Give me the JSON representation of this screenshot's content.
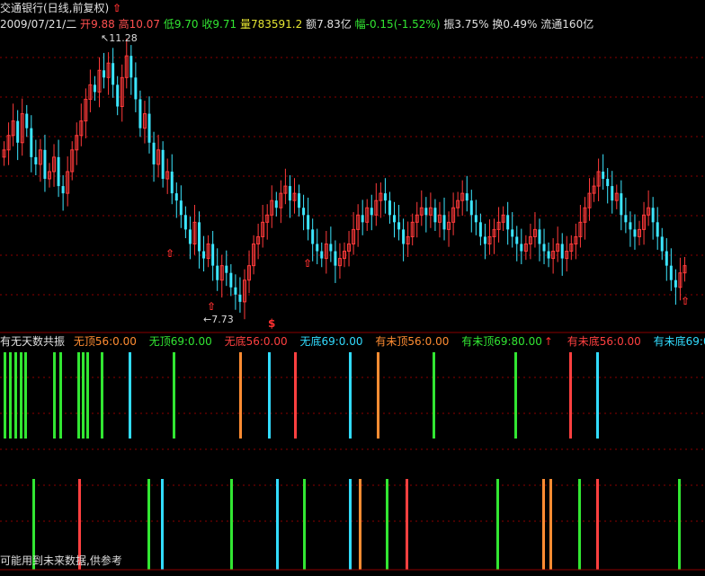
{
  "header": {
    "stock_name": "交通银行(日线,前复权)",
    "date": "2009/07/21/二",
    "open_label": "开",
    "open": "9.88",
    "high_label": "高",
    "high": "10.07",
    "low_label": "低",
    "low": "9.70",
    "close_label": "收",
    "close": "9.71",
    "volume_label": "量",
    "volume": "783591.2",
    "amount_label": "额",
    "amount": "7.83亿",
    "change_label": "幅",
    "change": "-0.15(-1.52%)",
    "amplitude_label": "振",
    "amplitude": "3.75%",
    "turnover_label": "换",
    "turnover": "0.49%",
    "float_label": "流通",
    "float": "160亿"
  },
  "price_chart": {
    "max_label": "11.28",
    "min_label": "7.73",
    "marker_symbol": "$"
  },
  "indicator": {
    "title": "有无天数共振",
    "items": [
      {
        "text": "无顶56:0.00",
        "color": "#ff8c32"
      },
      {
        "text": "无顶69:0.00",
        "color": "#32e632"
      },
      {
        "text": "无底56:0.00",
        "color": "#ff4040"
      },
      {
        "text": "无底69:0.00",
        "color": "#32dcff"
      },
      {
        "text": "有未顶56:0.00",
        "color": "#ff8c32"
      },
      {
        "text": "有未顶69:80.00",
        "color": "#32e632"
      },
      {
        "text": "有未底56:0.00",
        "color": "#ff4040"
      },
      {
        "text": "有未底69:0.00",
        "color": "#32dcff"
      }
    ]
  },
  "footer": {
    "note": "可能用到未来数据,供参考"
  },
  "colors": {
    "up": "#ff3a3a",
    "down": "#3ce6ff",
    "green": "#32e632",
    "orange": "#ff8c32",
    "red": "#ff4040",
    "cyan": "#32dcff",
    "grid": "#8b0000"
  },
  "chart_data": {
    "type": "candlestick",
    "price_range": [
      7.6,
      11.5
    ],
    "high_value": 11.28,
    "low_value": 7.73,
    "closes": [
      9.9,
      10.1,
      10.3,
      10.0,
      10.4,
      10.2,
      9.8,
      9.7,
      9.9,
      9.5,
      9.6,
      9.8,
      9.4,
      9.3,
      9.6,
      9.9,
      10.1,
      10.3,
      10.6,
      10.8,
      10.7,
      11.0,
      10.9,
      11.1,
      10.8,
      10.5,
      10.9,
      11.2,
      10.9,
      10.6,
      10.2,
      10.4,
      10.0,
      9.7,
      9.9,
      9.5,
      9.6,
      9.3,
      9.2,
      9.0,
      8.8,
      8.6,
      8.9,
      8.5,
      8.4,
      8.6,
      8.3,
      8.1,
      8.3,
      8.2,
      8.0,
      7.9,
      7.8,
      8.1,
      8.3,
      8.6,
      8.7,
      8.9,
      9.0,
      9.2,
      9.1,
      9.3,
      9.4,
      9.2,
      9.3,
      9.1,
      9.0,
      8.8,
      8.6,
      8.5,
      8.4,
      8.6,
      8.5,
      8.3,
      8.4,
      8.5,
      8.6,
      8.8,
      9.0,
      8.9,
      9.1,
      9.0,
      9.2,
      9.3,
      9.2,
      9.0,
      8.9,
      8.8,
      8.6,
      8.7,
      8.9,
      9.0,
      9.1,
      9.0,
      9.1,
      8.9,
      9.0,
      8.8,
      8.9,
      9.1,
      9.2,
      9.3,
      9.2,
      9.0,
      8.9,
      8.7,
      8.6,
      8.7,
      8.8,
      8.9,
      9.0,
      8.8,
      8.7,
      8.6,
      8.5,
      8.6,
      8.7,
      8.8,
      8.6,
      8.5,
      8.4,
      8.5,
      8.6,
      8.4,
      8.5,
      8.6,
      8.7,
      8.9,
      9.1,
      9.3,
      9.4,
      9.6,
      9.5,
      9.4,
      9.2,
      9.3,
      9.0,
      8.9,
      8.8,
      8.7,
      8.8,
      9.0,
      9.1,
      8.9,
      8.7,
      8.5,
      8.3,
      8.1,
      8.0,
      8.2,
      8.3
    ]
  }
}
